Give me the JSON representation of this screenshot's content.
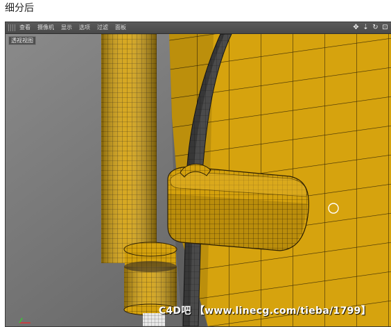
{
  "caption": "细分后",
  "viewport": {
    "menu": [
      "查看",
      "摄像机",
      "显示",
      "选项",
      "过滤",
      "面板"
    ],
    "view_label": "透视视图",
    "nav_icons": [
      "move-icon",
      "zoom-icon",
      "rotate-icon",
      "maximize-icon"
    ],
    "nav_glyphs": [
      "✥",
      "⇣",
      "↻",
      "⊡"
    ],
    "cursor_icon": "selection-circle-icon"
  },
  "watermark": "C4D吧 【www.linecg.com/tieba/1799】",
  "colors": {
    "mesh_yellow": "#d5a20f",
    "mesh_line": "#2a1f05",
    "rubber_dark": "#3c3c3c",
    "background_gray": "#5e5e5e"
  }
}
